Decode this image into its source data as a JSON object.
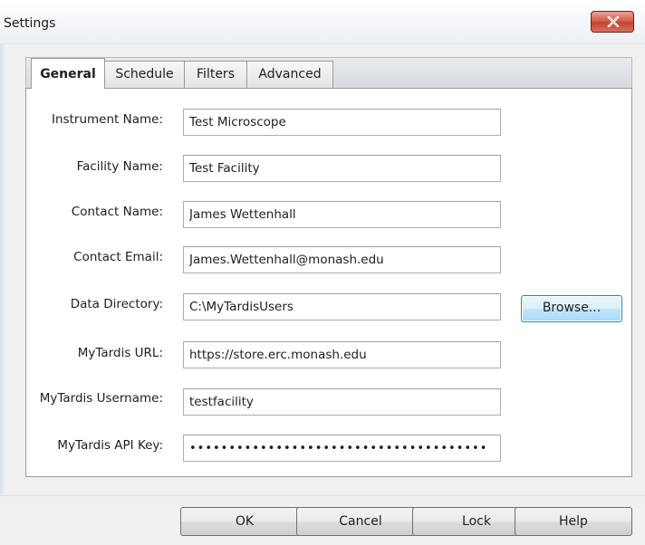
{
  "window": {
    "title": "Settings",
    "close_icon": "close-icon"
  },
  "tabs": [
    {
      "label": "General",
      "active": true
    },
    {
      "label": "Schedule",
      "active": false
    },
    {
      "label": "Filters",
      "active": false
    },
    {
      "label": "Advanced",
      "active": false
    }
  ],
  "form": {
    "instrument_name": {
      "label": "Instrument Name:",
      "value": "Test Microscope"
    },
    "facility_name": {
      "label": "Facility Name:",
      "value": "Test Facility"
    },
    "contact_name": {
      "label": "Contact Name:",
      "value": "James Wettenhall"
    },
    "contact_email": {
      "label": "Contact Email:",
      "value": "James.Wettenhall@monash.edu"
    },
    "data_directory": {
      "label": "Data Directory:",
      "value": "C:\\MyTardisUsers",
      "browse_label": "Browse..."
    },
    "mytardis_url": {
      "label": "MyTardis URL:",
      "value": "https://store.erc.monash.edu"
    },
    "mytardis_username": {
      "label": "MyTardis Username:",
      "value": "testfacility"
    },
    "mytardis_api_key": {
      "label": "MyTardis API Key:",
      "value": "••••••••••••••••••••••••••••••••••••••"
    }
  },
  "footer": {
    "ok_label": "OK",
    "cancel_label": "Cancel",
    "lock_label": "Lock",
    "help_label": "Help"
  }
}
